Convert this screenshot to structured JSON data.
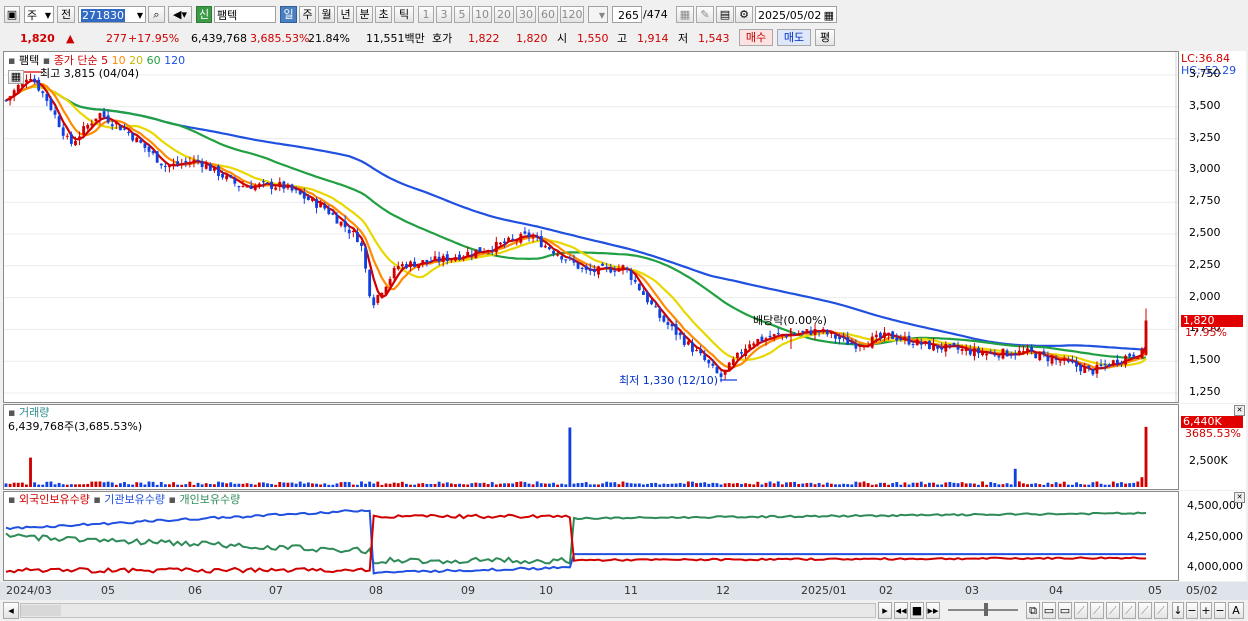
{
  "toolbar": {
    "period_type": "주",
    "prev_label": "전",
    "code": "271830",
    "new_badge": "신",
    "stock_name": "팸텍",
    "period_buttons": [
      "일",
      "주",
      "월",
      "년",
      "분",
      "초",
      "틱"
    ],
    "intervals": [
      "1",
      "3",
      "5",
      "10",
      "20",
      "30",
      "60",
      "120"
    ],
    "page_current": "265",
    "page_total": "/474",
    "date": "2025/05/02"
  },
  "quote": {
    "price": "1,820",
    "change": "277",
    "change_pct": "+17.95%",
    "volume": "6,439,768",
    "volume_ratio": "3,685.53%",
    "turnover": "21.84%",
    "amount": "11,551백만",
    "bid_label": "호가",
    "bid": "1,822",
    "ask": "1,820",
    "open_label": "시",
    "open": "1,550",
    "high_label": "고",
    "high": "1,914",
    "low_label": "저",
    "low": "1,543",
    "buy_label": "매수",
    "sell_label": "매도",
    "eval_label": "평"
  },
  "price_panel": {
    "stock": "팸텍",
    "ma_title": "종가 단순",
    "ma_periods": [
      "5",
      "10",
      "20",
      "60",
      "120"
    ],
    "ma_colors": [
      "#d00000",
      "#ff8c00",
      "#e8d800",
      "#20a040",
      "#2050e0"
    ],
    "high_note": "최고 3,815 (04/04)",
    "low_note": "최저 1,330 (12/10)",
    "dividend_note": "배당락(0.00%)",
    "lc": "LC:36.84",
    "hc": "HC:-52.29",
    "cur_price": "1,820",
    "cur_pct": "17.95%",
    "y_ticks": [
      "3,750",
      "3,500",
      "3,250",
      "3,000",
      "2,750",
      "2,500",
      "2,250",
      "2,000",
      "1,750",
      "1,500",
      "1,250"
    ]
  },
  "volume_panel": {
    "title": "거래량",
    "value": "6,439,768주(3,685.53%)",
    "cur": "6,440K",
    "cur_pct": "3685.53%",
    "y_tick": "2,500K"
  },
  "holding_panel": {
    "legend": [
      "외국인보유수량",
      "기관보유수량",
      "개인보유수량"
    ],
    "legend_colors": [
      "#d00000",
      "#2050e0",
      "#2e8b57"
    ],
    "y_ticks": [
      "4,500,000",
      "4,250,000",
      "4,000,000"
    ]
  },
  "x_axis": [
    "2024/03",
    "05",
    "06",
    "07",
    "08",
    "09",
    "10",
    "11",
    "12",
    "2025/01",
    "02",
    "03",
    "04",
    "05"
  ],
  "x_axis_right": "05/02",
  "chart_data": {
    "type": "candlestick",
    "ylim": [
      1250,
      3750
    ],
    "high": {
      "value": 3815,
      "date": "04/04"
    },
    "low": {
      "value": 1330,
      "date": "12/10"
    },
    "last": {
      "open": 1550,
      "high": 1914,
      "low": 1543,
      "close": 1820
    }
  }
}
